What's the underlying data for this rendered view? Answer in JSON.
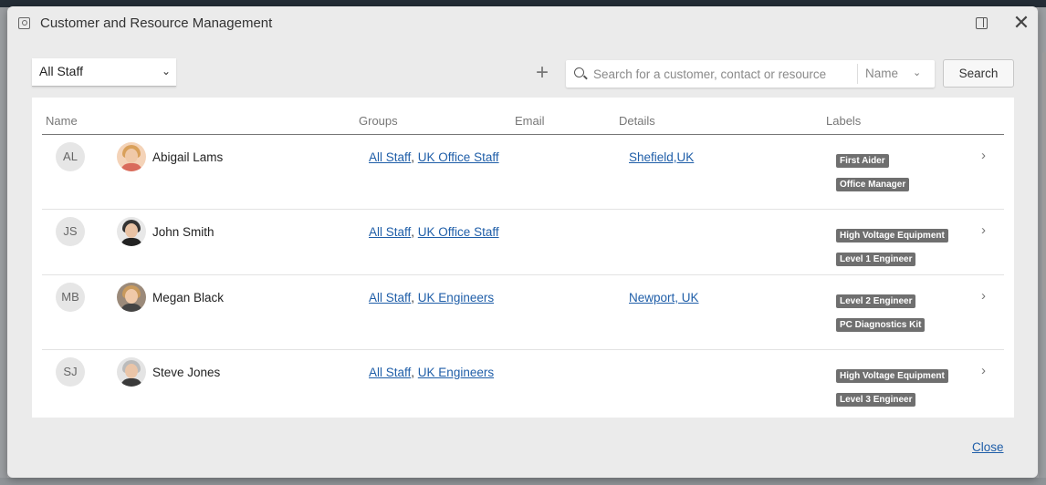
{
  "window": {
    "title": "Customer and Resource Management",
    "panel_icon": "panel-toggle-icon",
    "close_icon": "close-icon"
  },
  "toolbar": {
    "staff_filter": "All Staff",
    "add_label": "+",
    "search_placeholder": "Search for a customer, contact or resource...",
    "search_field": "Name",
    "search_button": "Search"
  },
  "table": {
    "headers": {
      "name": "Name",
      "groups": "Groups",
      "email": "Email",
      "details": "Details",
      "labels": "Labels"
    },
    "rows": [
      {
        "initials": "AL",
        "name": "Abigail Lams",
        "groups": [
          "All Staff",
          "UK Office Staff"
        ],
        "email": "",
        "details": "Shefield,UK",
        "labels": [
          "First Aider",
          "Office Manager"
        ]
      },
      {
        "initials": "JS",
        "name": "John Smith",
        "groups": [
          "All Staff",
          "UK Office Staff"
        ],
        "email": "",
        "details": "",
        "labels": [
          "High Voltage Equipment",
          "Level 1 Engineer"
        ]
      },
      {
        "initials": "MB",
        "name": "Megan Black",
        "groups": [
          "All Staff",
          "UK Engineers"
        ],
        "email": "",
        "details": "Newport, UK",
        "labels": [
          "Level 2 Engineer",
          "PC Diagnostics Kit"
        ]
      },
      {
        "initials": "SJ",
        "name": "Steve Jones",
        "groups": [
          "All Staff",
          "UK Engineers"
        ],
        "email": "",
        "details": "",
        "labels": [
          "High Voltage Equipment",
          "Level 3 Engineer"
        ]
      }
    ]
  },
  "footer": {
    "close_label": "Close"
  },
  "colors": {
    "link": "#1f5ea8",
    "label_bg": "#6f6f6f",
    "dialog_bg": "#ebebeb"
  }
}
